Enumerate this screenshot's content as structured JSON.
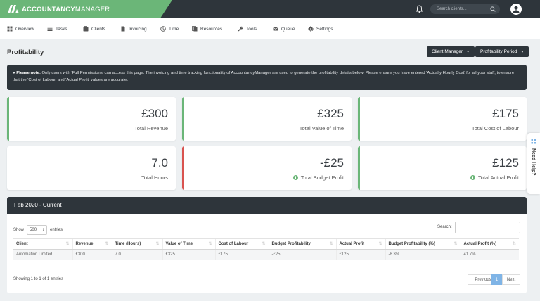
{
  "app": {
    "brand_left": "ACCOUNTANCY",
    "brand_right": "MANAGER"
  },
  "topbar": {
    "search_placeholder": "Search clients..."
  },
  "nav": [
    {
      "label": "Overview",
      "icon": "overview-icon"
    },
    {
      "label": "Tasks",
      "icon": "tasks-icon"
    },
    {
      "label": "Clients",
      "icon": "clients-icon"
    },
    {
      "label": "Invoicing",
      "icon": "invoicing-icon"
    },
    {
      "label": "Time",
      "icon": "clock-icon"
    },
    {
      "label": "Resources",
      "icon": "resources-icon"
    },
    {
      "label": "Tools",
      "icon": "wrench-icon"
    },
    {
      "label": "Queue",
      "icon": "queue-icon"
    },
    {
      "label": "Settings",
      "icon": "gear-icon"
    }
  ],
  "page": {
    "title": "Profitability",
    "client_manager_btn": "Client Manager",
    "profitability_period_btn": "Profitability Period"
  },
  "notice": {
    "bold": "Please note:",
    "text": " Only users with 'Full Permissions' can access this page. The invoicing and time tracking functionality of AccountancyManager are used to generate the profitability details below. Please ensure you have entered 'Actually Hourly Cost' for all your staff, to ensure that the 'Cost of Labour' and 'Actual Profit' values are accurate."
  },
  "stats": [
    {
      "value": "£300",
      "label": "Total Revenue",
      "color": "#6bb678"
    },
    {
      "value": "£325",
      "label": "Total Value of Time",
      "color": "#6bb678"
    },
    {
      "value": "£175",
      "label": "Total Cost of Labour",
      "color": "#6bb678"
    },
    {
      "value": "7.0",
      "label": "Total Hours",
      "color": "#ffffff"
    },
    {
      "value": "-£25",
      "label": "Total Budget Profit",
      "color": "#d9534f"
    },
    {
      "value": "£125",
      "label": "Total Actual Profit",
      "color": "#6bb678"
    }
  ],
  "table_panel": {
    "heading": "Feb 2020 - Current",
    "show_label": "Show",
    "entries_label": "entries",
    "page_size": "500",
    "search_label": "Search:",
    "columns": [
      "Client",
      "Revenue",
      "Time (Hours)",
      "Value of Time",
      "Cost of Labour",
      "Budget Profitability",
      "Actual Profit",
      "Budget Profitability (%)",
      "Actual Profit (%)"
    ],
    "rows": [
      [
        "Automation Limited",
        "£300",
        "7.0",
        "£325",
        "£175",
        "-£25",
        "£125",
        "-8.3%",
        "41.7%"
      ]
    ],
    "info": "Showing 1 to 1 of 1 entries",
    "pager": {
      "previous": "Previous",
      "current": "1",
      "next": "Next"
    }
  },
  "help_tab": "Need Help?"
}
